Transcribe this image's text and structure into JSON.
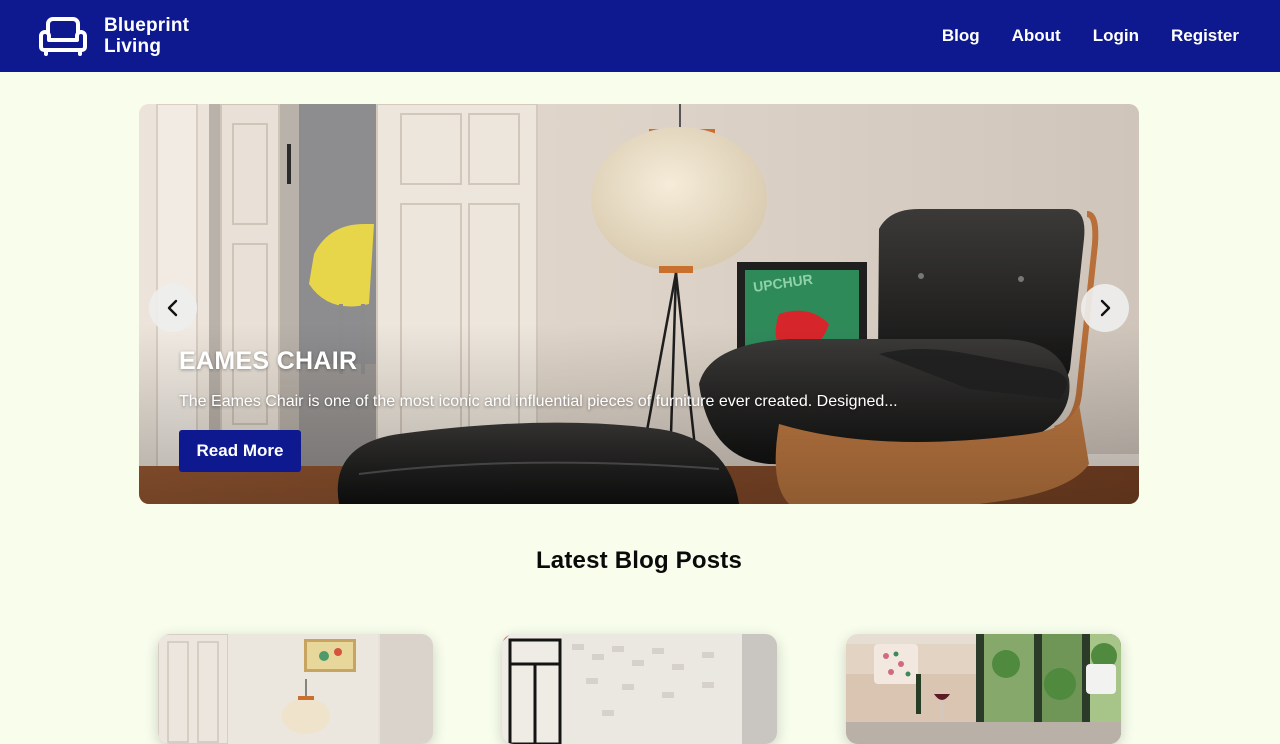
{
  "header": {
    "brand_line1": "Blueprint",
    "brand_line2": "Living",
    "brand_icon": "sofa-icon",
    "background": "#0e1990",
    "nav": [
      {
        "label": "Blog"
      },
      {
        "label": "About"
      },
      {
        "label": "Login"
      },
      {
        "label": "Register"
      }
    ]
  },
  "hero": {
    "title": "EAMES CHAIR",
    "excerpt": "The Eames Chair is one of the most iconic and influential pieces of furniture ever created. Designed...",
    "button_label": "Read More",
    "prev_icon": "chevron-left-icon",
    "next_icon": "chevron-right-icon"
  },
  "latest": {
    "title": "Latest Blog Posts"
  },
  "colors": {
    "primary": "#0e1990",
    "page_background": "#f8fdec"
  }
}
